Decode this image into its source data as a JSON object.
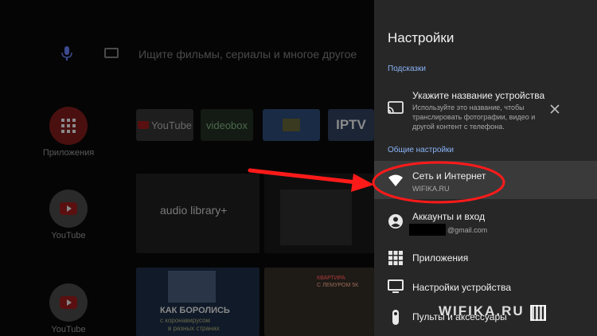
{
  "home": {
    "search_placeholder": "Ищите фильмы, сериалы и многое другое",
    "rail": [
      {
        "label": "Приложения"
      },
      {
        "label": "YouTube"
      },
      {
        "label": "YouTube"
      }
    ],
    "apps": [
      {
        "label": "YouTube"
      },
      {
        "label": "videobox"
      },
      {
        "label": ""
      },
      {
        "label": "IPTV"
      }
    ],
    "rows": {
      "audio_library": "audio library+",
      "show_caption": "КАК БОРОЛИСЬ",
      "show_sub1": "с коронавирусом",
      "show_sub2": "в разных странах",
      "ad_top": "КВАРТИРА",
      "ad_bottom": "С ЛЕМУРОМ 5К"
    }
  },
  "settings": {
    "title": "Настройки",
    "section_hints": "Подсказки",
    "hint": {
      "title": "Укажите название устройства",
      "line1": "Используйте это название, чтобы",
      "line2": "транслировать фотографии, видео и",
      "line3": "другой контент с телефона."
    },
    "section_general": "Общие настройки",
    "network": {
      "title": "Сеть и Интернет",
      "sub": "WIFIKA.RU"
    },
    "accounts": {
      "title": "Аккаунты и вход",
      "sub": "@gmail.com"
    },
    "apps": {
      "title": "Приложения"
    },
    "device": {
      "title": "Настройки устройства"
    },
    "remotes": {
      "title": "Пульты и аксессуары"
    }
  },
  "watermark": "WIFIKA.RU",
  "colors": {
    "annotation_red": "#ff1a1a",
    "accent_blue": "#8ab4f8",
    "panel": "#272727"
  }
}
